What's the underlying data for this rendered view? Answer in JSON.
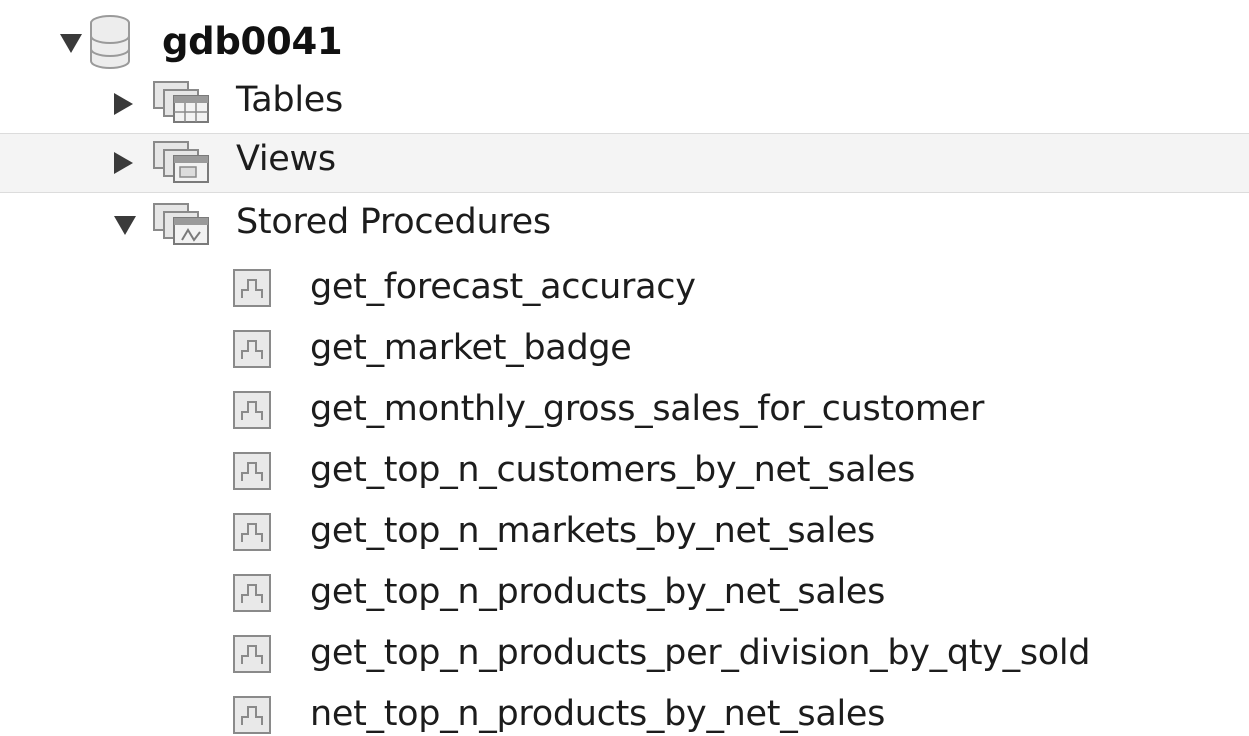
{
  "schema": {
    "name": "gdb0041",
    "icon": "database-icon",
    "expanded": true
  },
  "folders": [
    {
      "label": "Tables",
      "icon": "tables-folder-icon",
      "expanded": false
    },
    {
      "label": "Views",
      "icon": "views-folder-icon",
      "expanded": false,
      "selected": true
    },
    {
      "label": "Stored Procedures",
      "icon": "procedures-folder-icon",
      "expanded": true
    }
  ],
  "procedures": [
    "get_forecast_accuracy",
    "get_market_badge",
    "get_monthly_gross_sales_for_customer",
    "get_top_n_customers_by_net_sales",
    "get_top_n_markets_by_net_sales",
    "get_top_n_products_by_net_sales",
    "get_top_n_products_per_division_by_qty_sold",
    "net_top_n_products_by_net_sales"
  ],
  "colors": {
    "selected_row_bg": "#f4f4f4",
    "arrow": "#3a3a3a",
    "icon_stroke": "#8a8a8a"
  }
}
